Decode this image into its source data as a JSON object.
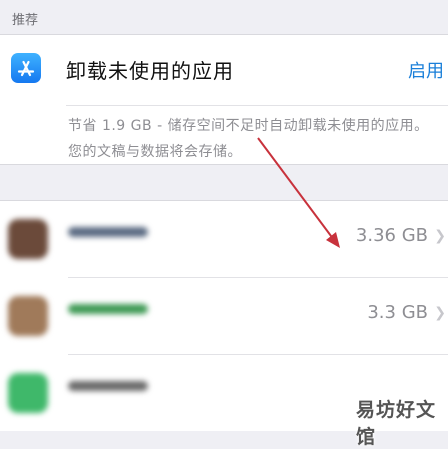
{
  "section": {
    "title": "推荐"
  },
  "recommendation": {
    "title": "卸载未使用的应用",
    "action": "启用",
    "description": "节省 1.9 GB - 储存空间不足时自动卸载未使用的应用。您的文稿与数据将会存储。"
  },
  "apps": [
    {
      "size": "3.36 GB",
      "icon_color": "#6b4a3a",
      "name_color": "#5a6a82"
    },
    {
      "size": "3.3 GB",
      "icon_color": "#a07a5a",
      "name_color": "#3f9a55"
    },
    {
      "size": "",
      "icon_color": "#3fb86a",
      "name_color": "#6a6a6a"
    }
  ],
  "watermark": {
    "text": "易坊好文馆"
  },
  "colors": {
    "accent": "#1a7fd9",
    "arrow": "#c8323c",
    "background": "#efeff4"
  },
  "icons": {
    "app_store": "app-store-icon",
    "chevron": "chevron-right-icon"
  }
}
